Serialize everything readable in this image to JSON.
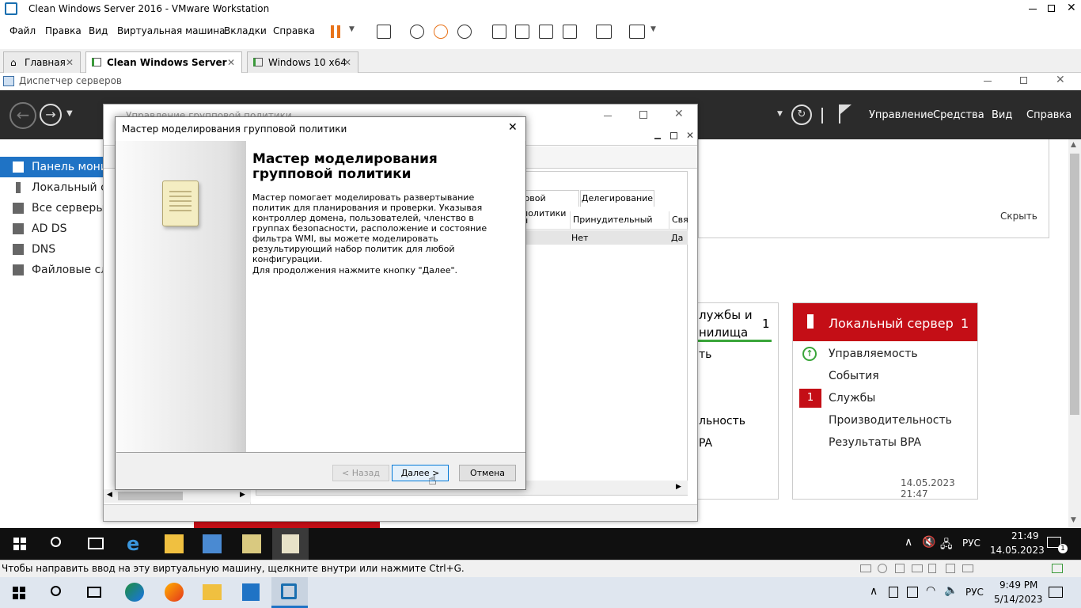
{
  "vmware": {
    "window_title": "Clean Windows Server 2016 - VMware Workstation",
    "menu": [
      "Файл",
      "Правка",
      "Вид",
      "Виртуальная машина",
      "Вкладки",
      "Справка"
    ],
    "tabs": [
      {
        "label": "Главная"
      },
      {
        "label": "Clean Windows Server 2016"
      },
      {
        "label": "Windows 10 x64"
      }
    ],
    "status_hint": "Чтобы направить ввод на эту виртуальную машину, щелкните внутри или нажмите Ctrl+G."
  },
  "server_manager": {
    "title": "Диспетчер серверов",
    "header_menu": [
      "Управление",
      "Средства",
      "Вид",
      "Справка"
    ],
    "sidebar": [
      {
        "label": "Панель мони"
      },
      {
        "label": "Локальный се"
      },
      {
        "label": "Все серверы"
      },
      {
        "label": "AD DS"
      },
      {
        "label": "DNS"
      },
      {
        "label": "Файловые слу"
      }
    ],
    "hide_label": "Скрыть",
    "tile_partial": {
      "title_line1": "лужбы и",
      "title_line2": "нилища",
      "count": "1",
      "rows": [
        "ть",
        "льность",
        "PA"
      ]
    },
    "tile_local": {
      "title": "Локальный сервер",
      "count": "1",
      "rows": [
        "Управляемость",
        "События",
        "Службы",
        "Производительность",
        "Результаты BPA"
      ],
      "services_badge": "1",
      "timestamp": "14.05.2023 21:47"
    }
  },
  "gpm": {
    "title": "Управление групповой политики",
    "tabs": [
      "ювой политики",
      "Делегирование"
    ],
    "columns": [
      "н",
      "Принудительный",
      "Свя"
    ],
    "row": [
      "",
      "Нет",
      "Да"
    ]
  },
  "wizard": {
    "title": "Мастер моделирования групповой политики",
    "heading": "Мастер моделирования групповой политики",
    "paragraph": "Мастер помогает моделировать развертывание политик для планирования и проверки. Указывая контроллер домена, пользователей, членство в группах безопасности, расположение и состояние фильтра WMI, вы можете моделировать результирующий набор политик для любой конфигурации.",
    "continue_text": "Для продолжения нажмите кнопку \"Далее\".",
    "back_label": "< Назад",
    "next_label": "Далее >",
    "cancel_label": "Отмена"
  },
  "guest_taskbar": {
    "lang": "РУС",
    "time": "21:49",
    "date": "14.05.2023",
    "notif_count": "1"
  },
  "host_taskbar": {
    "lang": "РУС",
    "time": "9:49 PM",
    "date": "5/14/2023"
  },
  "colors": {
    "accent_blue": "#1f73c5",
    "server_red": "#c40e16",
    "dark_header": "#2b2b2b"
  }
}
